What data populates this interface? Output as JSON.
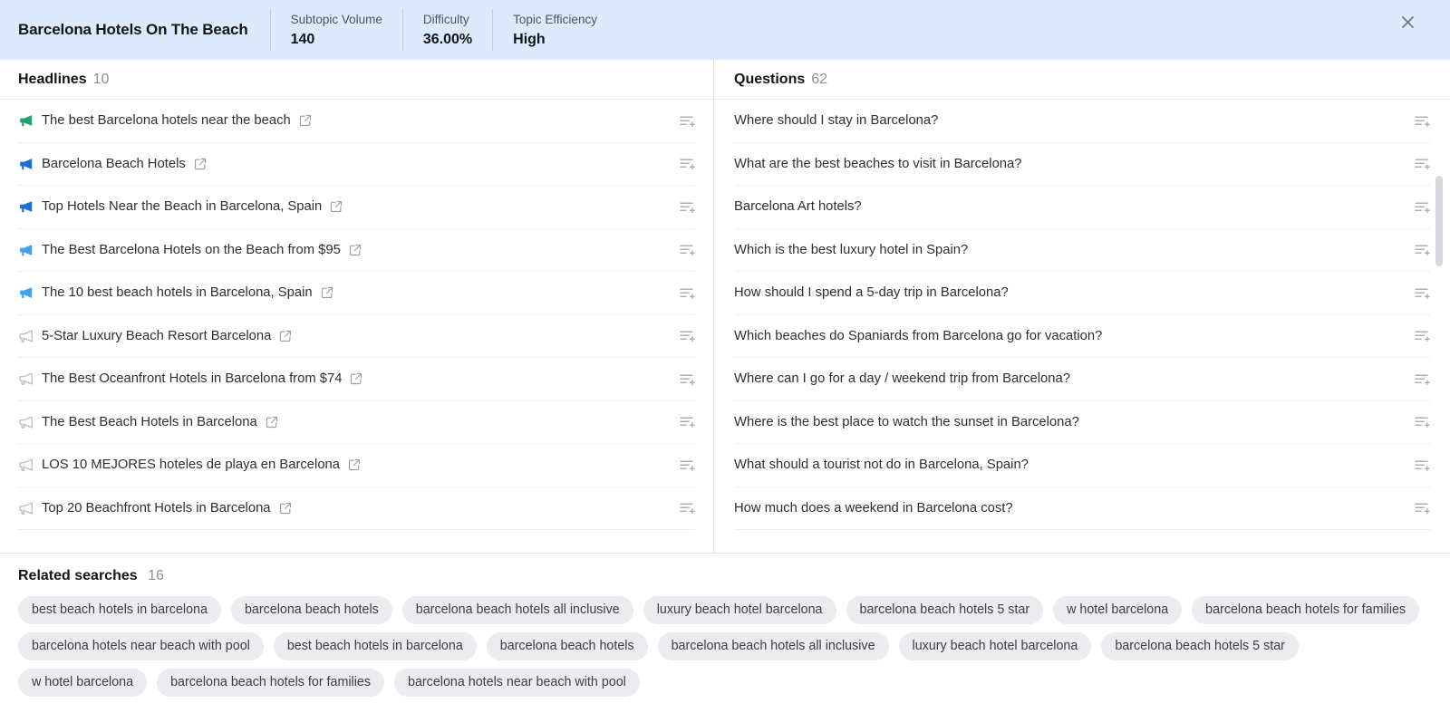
{
  "header": {
    "title": "Barcelona Hotels On The Beach",
    "metrics": [
      {
        "label": "Subtopic Volume",
        "value": "140"
      },
      {
        "label": "Difficulty",
        "value": "36.00%"
      },
      {
        "label": "Topic Efficiency",
        "value": "High"
      }
    ],
    "close_label": "×",
    "background_color": "#dceafb"
  },
  "headlines": {
    "title": "Headlines",
    "count": "10",
    "items": [
      {
        "text": "The best Barcelona hotels near the beach",
        "icon": "megaphone-icon",
        "icon_color": "#21a366",
        "icon_style": "filled"
      },
      {
        "text": "Barcelona Beach Hotels",
        "icon": "megaphone-icon",
        "icon_color": "#1b6fd8",
        "icon_style": "filled"
      },
      {
        "text": "Top Hotels Near the Beach in Barcelona, Spain",
        "icon": "megaphone-icon",
        "icon_color": "#1b6fd8",
        "icon_style": "filled"
      },
      {
        "text": "The Best Barcelona Hotels on the Beach from $95",
        "icon": "megaphone-icon",
        "icon_color": "#3fa0f7",
        "icon_style": "filled"
      },
      {
        "text": "The 10 best beach hotels in Barcelona, Spain",
        "icon": "megaphone-icon",
        "icon_color": "#3fa0f7",
        "icon_style": "filled"
      },
      {
        "text": "5-Star Luxury Beach Resort Barcelona",
        "icon": "megaphone-icon",
        "icon_color": "#b6b9c2",
        "icon_style": "outline"
      },
      {
        "text": "The Best Oceanfront Hotels in Barcelona from $74",
        "icon": "megaphone-icon",
        "icon_color": "#b6b9c2",
        "icon_style": "outline"
      },
      {
        "text": "The Best Beach Hotels in Barcelona",
        "icon": "megaphone-icon",
        "icon_color": "#b6b9c2",
        "icon_style": "outline"
      },
      {
        "text": "LOS 10 MEJORES hoteles de playa en Barcelona",
        "icon": "megaphone-icon",
        "icon_color": "#b6b9c2",
        "icon_style": "outline"
      },
      {
        "text": "Top 20 Beachfront Hotels in Barcelona",
        "icon": "megaphone-icon",
        "icon_color": "#b6b9c2",
        "icon_style": "outline"
      }
    ],
    "row_action_icon": "add-to-list-icon",
    "external_link_icon": "external-link-icon"
  },
  "questions": {
    "title": "Questions",
    "count": "62",
    "items": [
      {
        "text": "Where should I stay in Barcelona?"
      },
      {
        "text": "What are the best beaches to visit in Barcelona?"
      },
      {
        "text": "Barcelona Art hotels?"
      },
      {
        "text": "Which is the best luxury hotel in Spain?"
      },
      {
        "text": "How should I spend a 5-day trip in Barcelona?"
      },
      {
        "text": "Which beaches do Spaniards from Barcelona go for vacation?"
      },
      {
        "text": "Where can I go for a day / weekend trip from Barcelona?"
      },
      {
        "text": "Where is the best place to watch the sunset in Barcelona?"
      },
      {
        "text": "What should a tourist not do in Barcelona, Spain?"
      },
      {
        "text": "How much does a weekend in Barcelona cost?"
      }
    ],
    "row_action_icon": "add-to-list-icon"
  },
  "related_searches": {
    "title": "Related searches",
    "count": "16",
    "items": [
      "best beach hotels in barcelona",
      "barcelona beach hotels",
      "barcelona beach hotels all inclusive",
      "luxury beach hotel barcelona",
      "barcelona beach hotels 5 star",
      "w hotel barcelona",
      "barcelona beach hotels for families",
      "barcelona hotels near beach with pool",
      "best beach hotels in barcelona",
      "barcelona beach hotels",
      "barcelona beach hotels all inclusive",
      "luxury beach hotel barcelona",
      "barcelona beach hotels 5 star",
      "w hotel barcelona",
      "barcelona beach hotels for families",
      "barcelona hotels near beach with pool"
    ]
  }
}
